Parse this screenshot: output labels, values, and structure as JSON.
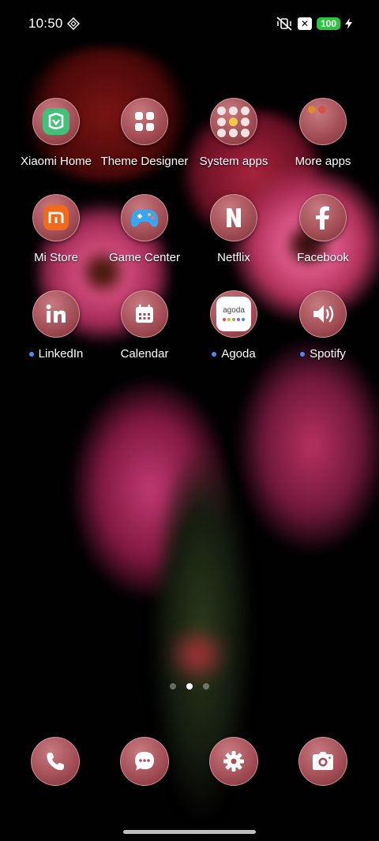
{
  "status_bar": {
    "time": "10:50",
    "battery_level": "100",
    "icons": [
      "grid-diamond-icon",
      "mute-vibrate-icon",
      "x-box-icon",
      "battery-icon",
      "charging-bolt-icon"
    ]
  },
  "apps": [
    {
      "name": "xiaomi-home",
      "label": "Xiaomi Home",
      "icon": "mi-home-icon",
      "new_dot": false
    },
    {
      "name": "theme-designer",
      "label": "Theme Designer",
      "icon": "four-squares-icon",
      "new_dot": false
    },
    {
      "name": "system-apps",
      "label": "System apps",
      "icon": "folder-icon",
      "new_dot": false
    },
    {
      "name": "more-apps",
      "label": "More apps",
      "icon": "folder-icon",
      "new_dot": false
    },
    {
      "name": "mi-store",
      "label": "Mi Store",
      "icon": "mi-store-icon",
      "new_dot": false
    },
    {
      "name": "game-center",
      "label": "Game Center",
      "icon": "gamepad-icon",
      "new_dot": false
    },
    {
      "name": "netflix",
      "label": "Netflix",
      "icon": "netflix-n-icon",
      "new_dot": false
    },
    {
      "name": "facebook",
      "label": "Facebook",
      "icon": "facebook-f-icon",
      "new_dot": false
    },
    {
      "name": "linkedin",
      "label": "LinkedIn",
      "icon": "linkedin-in-icon",
      "new_dot": true
    },
    {
      "name": "calendar",
      "label": "Calendar",
      "icon": "calendar-icon",
      "new_dot": false
    },
    {
      "name": "agoda",
      "label": "Agoda",
      "icon": "agoda-icon",
      "logo_text": "agoda",
      "new_dot": true
    },
    {
      "name": "spotify",
      "label": "Spotify",
      "icon": "speaker-icon",
      "new_dot": true
    }
  ],
  "dock": [
    {
      "name": "phone",
      "icon": "phone-icon"
    },
    {
      "name": "messages",
      "icon": "message-bubble-icon"
    },
    {
      "name": "settings",
      "icon": "gear-icon"
    },
    {
      "name": "camera",
      "icon": "camera-icon"
    }
  ],
  "page_indicator": {
    "pages": 3,
    "current": 2
  },
  "colors": {
    "icon_bg": "#a55058",
    "new_dot": "#4d8cf0",
    "battery": "#2dc43f"
  }
}
